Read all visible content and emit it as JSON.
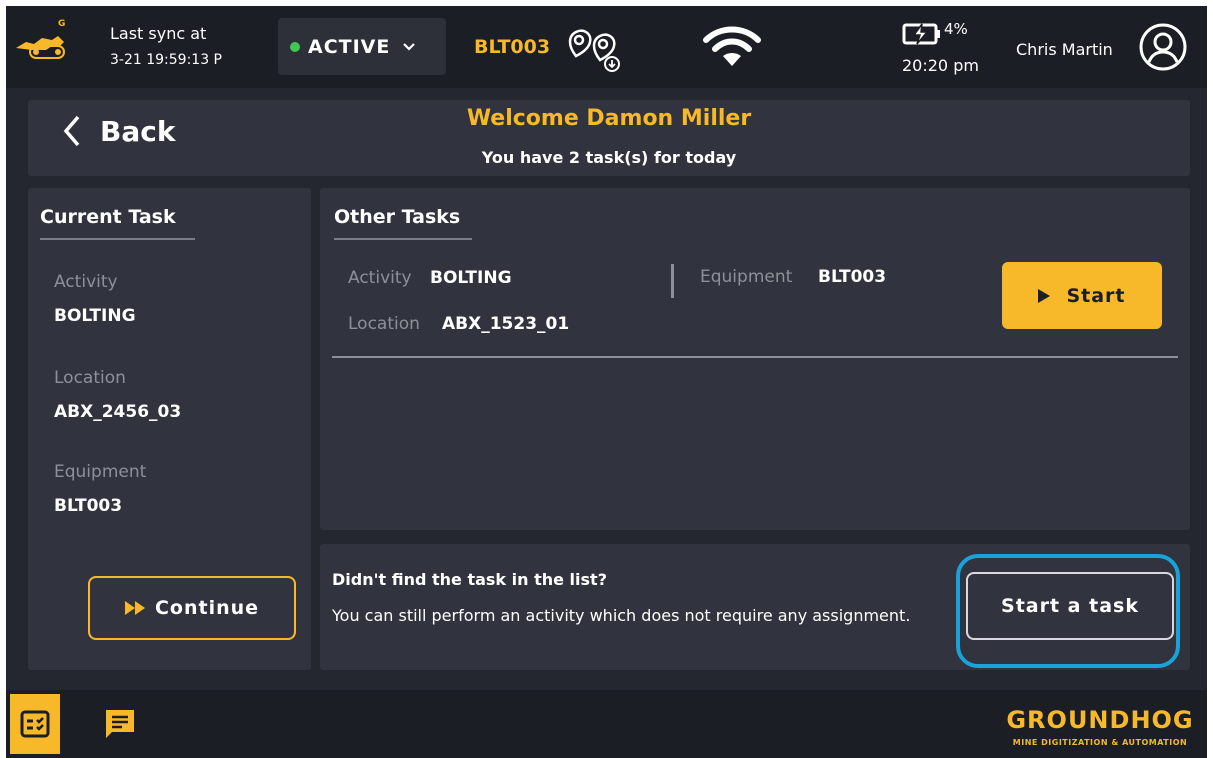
{
  "topbar": {
    "sync_label": "Last sync at",
    "sync_time": "3-21 19:59:13 P",
    "status": "ACTIVE",
    "equipment": "BLT003",
    "battery_pct": "4%",
    "clock": "20:20 pm",
    "user_name": "Chris Martin"
  },
  "header": {
    "back_label": "Back",
    "welcome": "Welcome Damon Miller",
    "subtitle": "You have 2 task(s) for today"
  },
  "current_task": {
    "title": "Current Task",
    "activity_label": "Activity",
    "activity_value": "BOLTING",
    "location_label": "Location",
    "location_value": "ABX_2456_03",
    "equipment_label": "Equipment",
    "equipment_value": "BLT003",
    "continue_label": "Continue"
  },
  "other_tasks": {
    "title": "Other Tasks",
    "items": [
      {
        "activity_label": "Activity",
        "activity_value": "BOLTING",
        "equipment_label": "Equipment",
        "equipment_value": "BLT003",
        "location_label": "Location",
        "location_value": "ABX_1523_01",
        "start_label": "Start"
      }
    ]
  },
  "no_assignment": {
    "question": "Didn't find the task in the list?",
    "text": "You can still perform an activity which does not require any assignment.",
    "button_label": "Start a task"
  },
  "bottombar": {
    "brand": "GROUNDHOG",
    "brand_sub": "MINE DIGITIZATION & AUTOMATION"
  },
  "colors": {
    "accent": "#f7b82a",
    "background": "#24272f",
    "panel": "#31343e",
    "status_active": "#3ec84f",
    "highlight": "#1aa3db"
  },
  "icons": [
    "machine-logo-icon",
    "chevron-down-icon",
    "location-pins-icon",
    "wifi-icon",
    "battery-charging-icon",
    "user-avatar-icon",
    "chevron-left-icon",
    "fast-forward-icon",
    "play-icon",
    "task-list-icon",
    "chat-icon"
  ]
}
